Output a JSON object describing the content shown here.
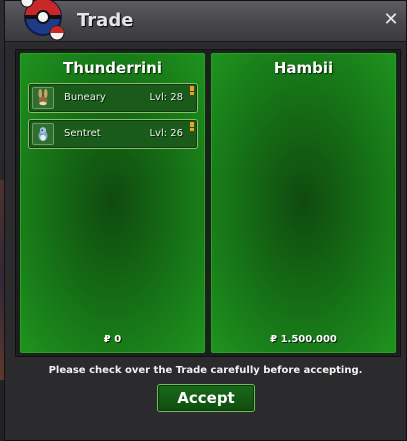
{
  "window": {
    "title": "Trade",
    "close_icon": "close-icon"
  },
  "left_panel": {
    "player": "Thunderrini",
    "money": "0",
    "money_symbol": "₽",
    "pokemon": [
      {
        "name": "Buneary",
        "level": "Lvl: 28",
        "icon": "buneary-icon"
      },
      {
        "name": "Sentret",
        "level": "Lvl: 26",
        "icon": "sentret-icon"
      }
    ]
  },
  "right_panel": {
    "player": "Hambii",
    "money": "1.500.000",
    "money_symbol": "₽",
    "pokemon": []
  },
  "notice": "Please check over the Trade carefully before accepting.",
  "accept_label": "Accept",
  "colors": {
    "panel_green": "#187a18",
    "accept_green": "#1a6a1a",
    "accent_orange": "#f0a020"
  }
}
